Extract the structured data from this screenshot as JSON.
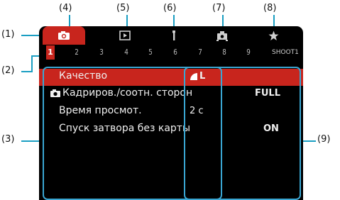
{
  "callouts": {
    "c1": "(1)",
    "c2": "(2)",
    "c3": "(3)",
    "c4": "(4)",
    "c5": "(5)",
    "c6": "(6)",
    "c7": "(7)",
    "c8": "(8)",
    "c9": "(9)"
  },
  "tabs": [
    {
      "icon": "camera-icon",
      "active": true
    },
    {
      "icon": "playback-icon",
      "active": false
    },
    {
      "icon": "wrench-icon",
      "active": false
    },
    {
      "icon": "custom-function-icon",
      "active": false
    },
    {
      "icon": "star-icon",
      "active": false
    }
  ],
  "pages": [
    "1",
    "2",
    "3",
    "4",
    "5",
    "6",
    "7",
    "8",
    "9"
  ],
  "active_page": "1",
  "tab_code": "SHOOT1",
  "menu": [
    {
      "label": "Качество",
      "value": "L",
      "selected": true
    },
    {
      "label": "Кадриров./соотн. сторон",
      "value": "FULL",
      "selected": false
    },
    {
      "label": "Время просмот.",
      "value": "2 с",
      "selected": false
    },
    {
      "label": "Спуск затвора без карты",
      "value": "ON",
      "selected": false
    }
  ],
  "colors": {
    "accent": "#c8251d",
    "highlight": "#3aa6d2",
    "callout_line": "#1a9ec2"
  }
}
